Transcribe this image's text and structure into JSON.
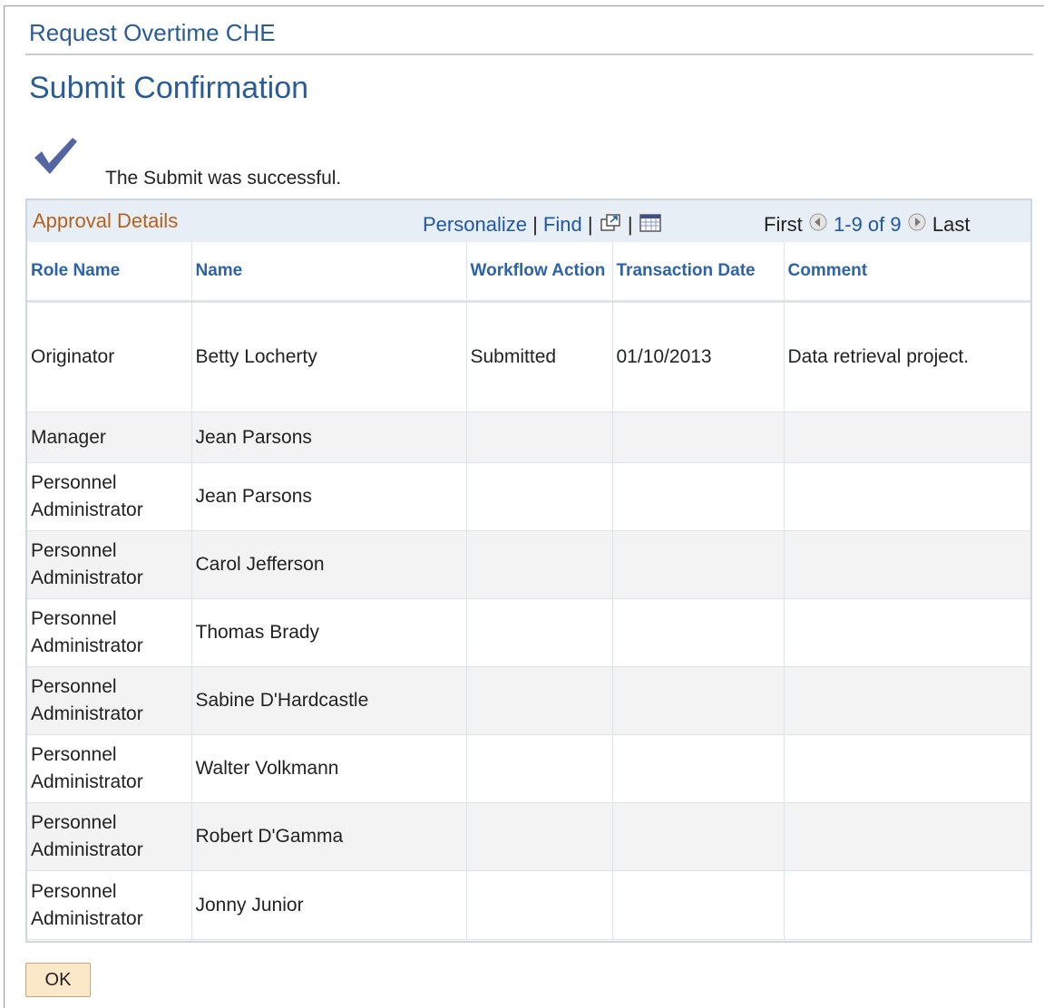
{
  "header": {
    "app_title": "Request Overtime CHE",
    "page_title": "Submit Confirmation"
  },
  "confirmation": {
    "icon": "checkmark-icon",
    "message": "The Submit was successful."
  },
  "grid": {
    "title": "Approval Details",
    "personalize_label": "Personalize",
    "find_label": "Find",
    "separator": "|",
    "first_label": "First",
    "range_label": "1-9 of 9",
    "last_label": "Last",
    "columns": [
      "Role Name",
      "Name",
      "Workflow Action",
      "Transaction Date",
      "Comment"
    ],
    "rows": [
      {
        "role": "Originator",
        "name": "Betty Locherty",
        "action": "Submitted",
        "date": "01/10/2013",
        "comment": "Data retrieval project."
      },
      {
        "role": "Manager",
        "name": "Jean Parsons",
        "action": "",
        "date": "",
        "comment": ""
      },
      {
        "role": "Personnel Administrator",
        "name": "Jean Parsons",
        "action": "",
        "date": "",
        "comment": ""
      },
      {
        "role": "Personnel Administrator",
        "name": "Carol Jefferson",
        "action": "",
        "date": "",
        "comment": ""
      },
      {
        "role": "Personnel Administrator",
        "name": "Thomas Brady",
        "action": "",
        "date": "",
        "comment": ""
      },
      {
        "role": "Personnel Administrator",
        "name": "Sabine D'Hardcastle",
        "action": "",
        "date": "",
        "comment": ""
      },
      {
        "role": "Personnel Administrator",
        "name": "Walter Volkmann",
        "action": "",
        "date": "",
        "comment": ""
      },
      {
        "role": "Personnel Administrator",
        "name": "Robert D'Gamma",
        "action": "",
        "date": "",
        "comment": ""
      },
      {
        "role": "Personnel Administrator",
        "name": "Jonny Junior",
        "action": "",
        "date": "",
        "comment": ""
      }
    ]
  },
  "footer": {
    "ok_label": "OK"
  },
  "colors": {
    "title_blue": "#2a5c95",
    "link_blue": "#1f57a3",
    "grid_title_orange": "#b3621e",
    "grid_header_bg": "#e8eef6",
    "button_bg": "#fbe8c8"
  }
}
